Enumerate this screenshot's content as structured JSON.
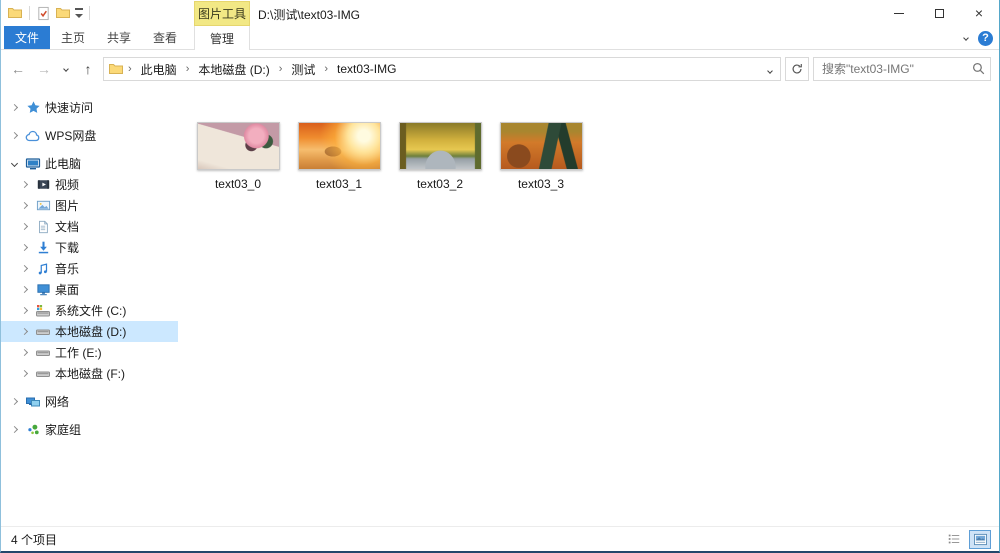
{
  "window": {
    "title": "D:\\测试\\text03-IMG",
    "controls": [
      "minimize-icon",
      "maximize-icon",
      "close-icon"
    ]
  },
  "quick_access_toolbar": {
    "icons": [
      "folder-icon",
      "properties-check-icon",
      "new-folder-icon",
      "customize-qat-dropdown-icon"
    ]
  },
  "ribbon": {
    "contextual_group_label": "图片工具",
    "contextual_tab_label": "管理",
    "tabs": [
      {
        "label": "文件",
        "active": true
      },
      {
        "label": "主页"
      },
      {
        "label": "共享"
      },
      {
        "label": "查看"
      }
    ],
    "right_icons": [
      "expand-ribbon-chevron-icon",
      "help-icon"
    ]
  },
  "toolbar": {
    "nav_icons": [
      "back-icon",
      "forward-icon",
      "recent-locations-chevron-icon",
      "up-icon"
    ],
    "address_icon": "folder-icon",
    "breadcrumb": [
      "此电脑",
      "本地磁盘 (D:)",
      "测试",
      "text03-IMG"
    ],
    "refresh_icon": "refresh-icon",
    "search_placeholder": "搜索\"text03-IMG\"",
    "search_icon": "search-icon"
  },
  "sidebar": {
    "items": [
      {
        "label": "快速访问",
        "icon": "star-icon",
        "level": 0,
        "state": "collapsed"
      },
      {
        "label": "WPS网盘",
        "icon": "cloud-icon",
        "level": 0,
        "state": "collapsed"
      },
      {
        "label": "此电脑",
        "icon": "computer-icon",
        "level": 0,
        "state": "expanded"
      },
      {
        "label": "视频",
        "icon": "videos-icon",
        "level": 1,
        "state": "collapsed"
      },
      {
        "label": "图片",
        "icon": "pictures-icon",
        "level": 1,
        "state": "collapsed"
      },
      {
        "label": "文档",
        "icon": "documents-icon",
        "level": 1,
        "state": "collapsed"
      },
      {
        "label": "下载",
        "icon": "downloads-icon",
        "level": 1,
        "state": "collapsed"
      },
      {
        "label": "音乐",
        "icon": "music-icon",
        "level": 1,
        "state": "collapsed"
      },
      {
        "label": "桌面",
        "icon": "desktop-icon",
        "level": 1,
        "state": "collapsed"
      },
      {
        "label": "系统文件 (C:)",
        "icon": "system-drive-icon",
        "level": 1,
        "state": "collapsed"
      },
      {
        "label": "本地磁盘 (D:)",
        "icon": "drive-icon",
        "level": 1,
        "state": "collapsed",
        "selected": true
      },
      {
        "label": "工作 (E:)",
        "icon": "drive-icon",
        "level": 1,
        "state": "collapsed"
      },
      {
        "label": "本地磁盘 (F:)",
        "icon": "drive-icon",
        "level": 1,
        "state": "collapsed"
      },
      {
        "label": "网络",
        "icon": "network-icon",
        "level": 0,
        "state": "collapsed"
      },
      {
        "label": "家庭组",
        "icon": "homegroup-icon",
        "level": 0,
        "state": "collapsed"
      }
    ]
  },
  "files": [
    {
      "name": "text03_0",
      "thumbnail": "pink-rose-on-sheet-music"
    },
    {
      "name": "text03_1",
      "thumbnail": "sunset-beach"
    },
    {
      "name": "text03_2",
      "thumbnail": "autumn-tree-lined-path"
    },
    {
      "name": "text03_3",
      "thumbnail": "autumn-park-bench"
    }
  ],
  "statusbar": {
    "items_count": "4 个项目",
    "view_icons": [
      "details-view-icon",
      "thumbnails-view-icon"
    ],
    "active_view": "thumbnails-view"
  },
  "colors": {
    "accent_blue": "#2b7cd3",
    "contextual_yellow": "#f2e885",
    "selection_blue": "#cce8ff"
  }
}
